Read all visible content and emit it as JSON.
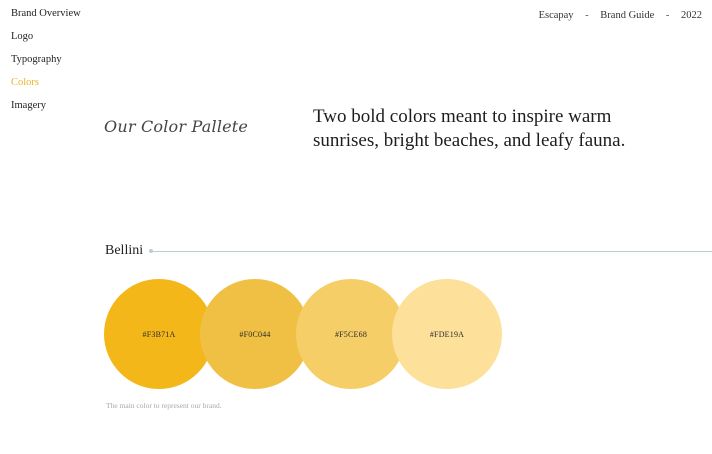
{
  "sidebar": {
    "items": [
      {
        "label": "Brand Overview",
        "active": false
      },
      {
        "label": "Logo",
        "active": false
      },
      {
        "label": "Typography",
        "active": false
      },
      {
        "label": "Colors",
        "active": true
      },
      {
        "label": "Imagery",
        "active": false
      }
    ]
  },
  "header": {
    "brand": "Escapay",
    "separator": "-",
    "guide": "Brand Guide",
    "year": "2022"
  },
  "page": {
    "script_title": "Our Color Pallete",
    "intro": "Two bold colors meant to inspire warm sunrises, bright beaches, and leafy fauna."
  },
  "palette": {
    "name": "Bellini",
    "swatches": [
      {
        "hex": "#F3B71A",
        "label": "#F3B71A"
      },
      {
        "hex": "#F0C044",
        "label": "#F0C044"
      },
      {
        "hex": "#F5CE68",
        "label": "#F5CE68"
      },
      {
        "hex": "#FDE19A",
        "label": "#FDE19A"
      }
    ],
    "caption": "The main color to represent our brand."
  },
  "colors": {
    "active_nav": "#e7b52a",
    "rule": "#b9cfd4"
  }
}
